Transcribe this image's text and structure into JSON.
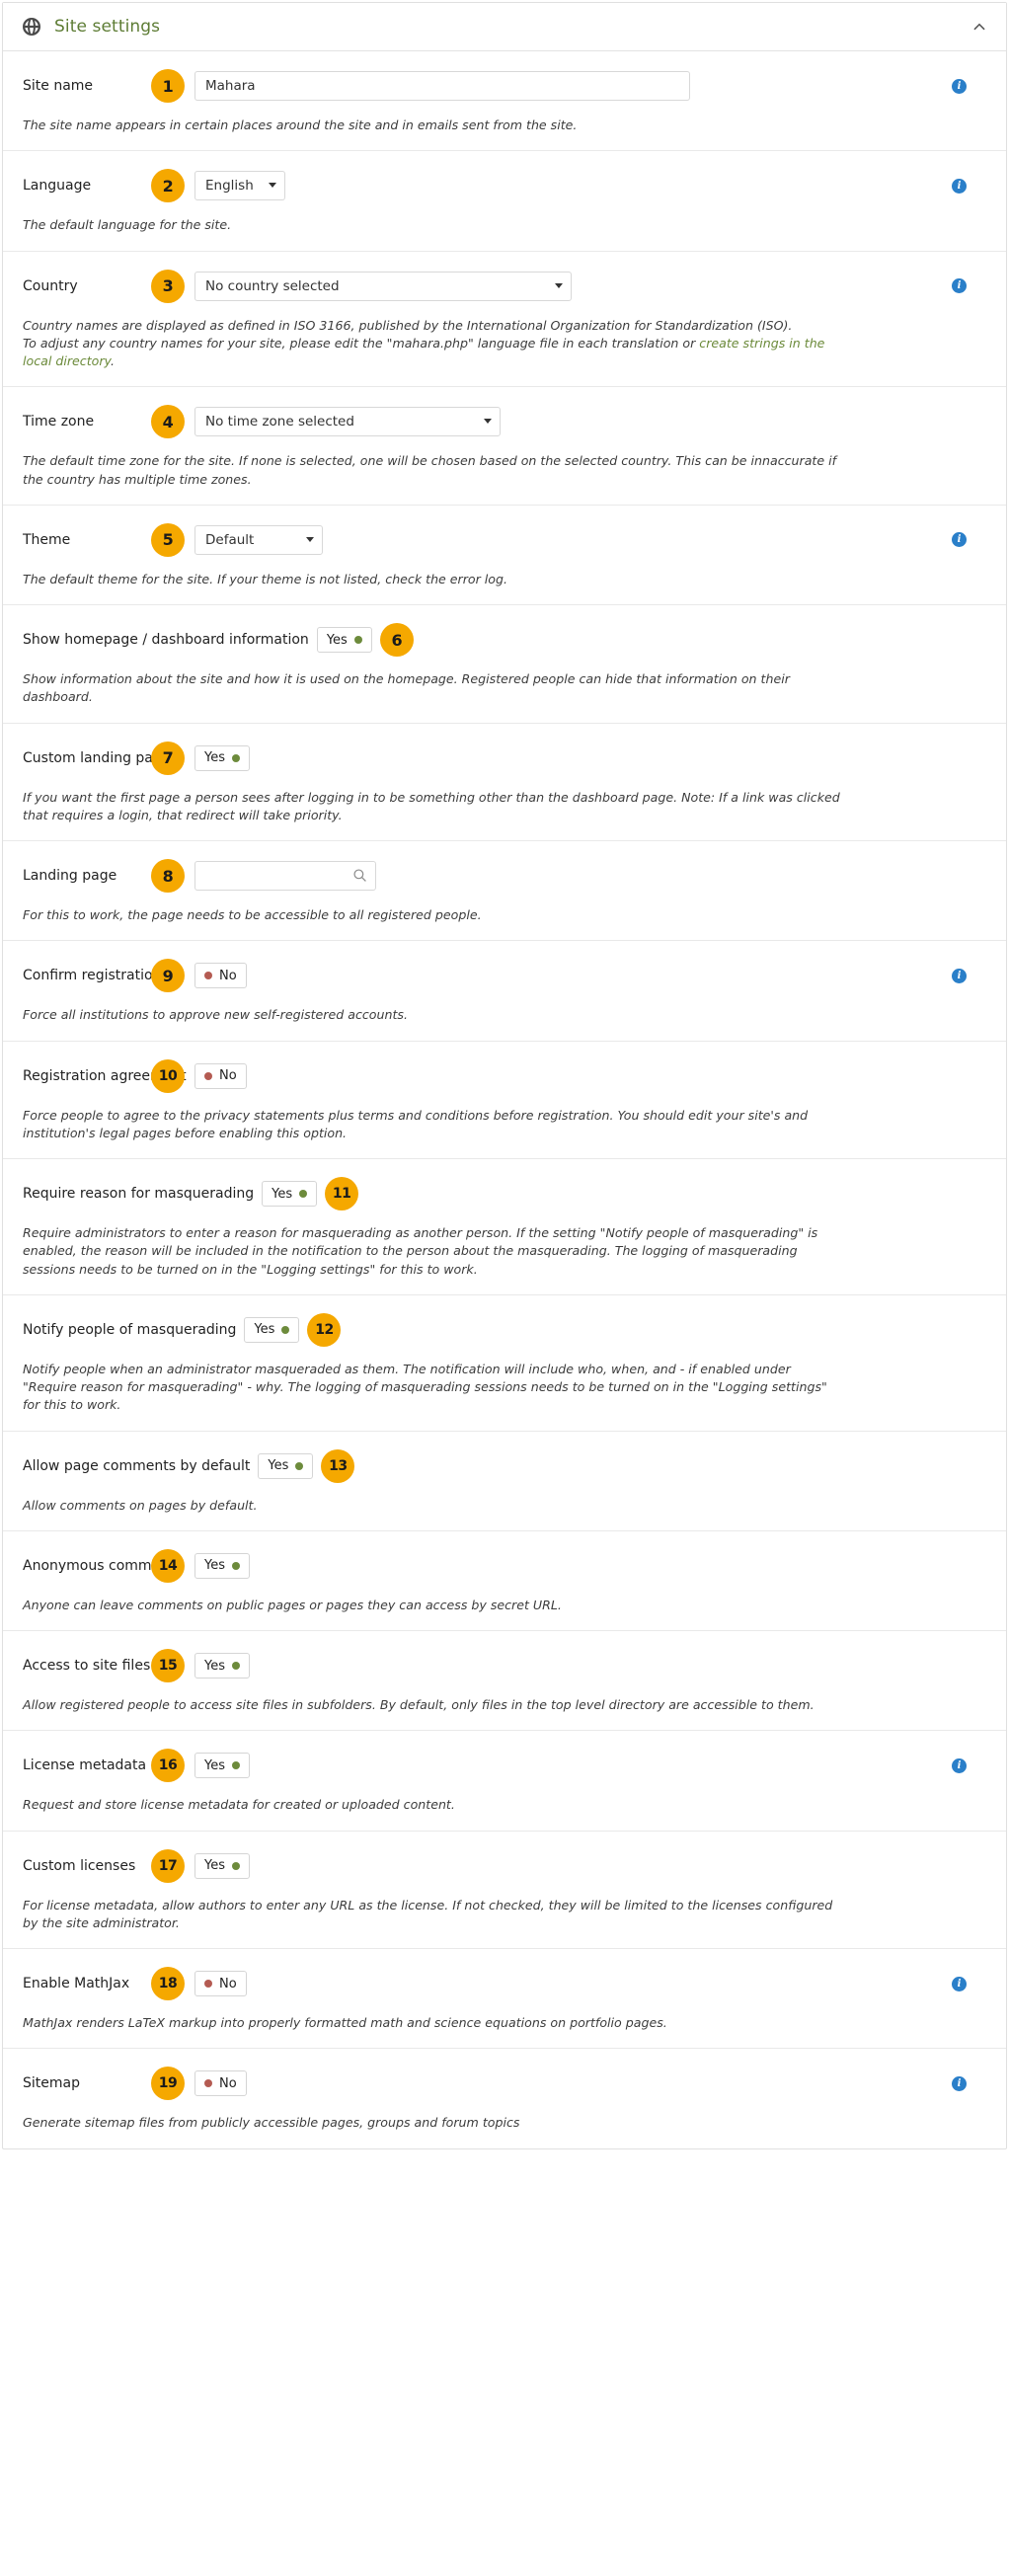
{
  "panel": {
    "title": "Site settings",
    "globe_icon": "globe-icon",
    "collapse_icon": "chevron-up-icon"
  },
  "rows": [
    {
      "num": "1",
      "label": "Site name",
      "control": "text",
      "value": "Mahara",
      "placeholder": "",
      "help": "The site name appears in certain places around the site and in emails sent from the site.",
      "info": true
    },
    {
      "num": "2",
      "label": "Language",
      "control": "select",
      "value": "English",
      "help": "The default language for the site.",
      "info": true
    },
    {
      "num": "3",
      "label": "Country",
      "control": "select",
      "value": "No country selected",
      "help_pre": "Country names are displayed as defined in ISO 3166, published by the International Organization for Standardization (ISO).\nTo adjust any country names for your site, please edit the \"mahara.php\" language file in each translation or ",
      "help_link": "create strings in the local directory",
      "help_post": ".",
      "info": true
    },
    {
      "num": "4",
      "label": "Time zone",
      "control": "select",
      "value": "No time zone selected",
      "help": "The default time zone for the site. If none is selected, one will be chosen based on the selected country. This can be innaccurate if the country has multiple time zones.",
      "info": false
    },
    {
      "num": "5",
      "label": "Theme",
      "control": "select",
      "value": "Default",
      "help": "The default theme for the site. If your theme is not listed, check the error log.",
      "info": true
    },
    {
      "num": "6",
      "label": "Show homepage / dashboard information",
      "control": "toggle",
      "value": "Yes",
      "badge_after": true,
      "help": "Show information about the site and how it is used on the homepage. Registered people can hide that information on their dashboard.",
      "info": false
    },
    {
      "num": "7",
      "label": "Custom landing page",
      "control": "toggle",
      "value": "Yes",
      "help": "If you want the first page a person sees after logging in to be something other than the dashboard page. Note: If a link was clicked that requires a login, that redirect will take priority.",
      "info": false
    },
    {
      "num": "8",
      "label": "Landing page",
      "control": "search",
      "value": "",
      "placeholder": "",
      "help": "For this to work, the page needs to be accessible to all registered people.",
      "info": false
    },
    {
      "num": "9",
      "label": "Confirm registration",
      "control": "toggle",
      "value": "No",
      "help": "Force all institutions to approve new self-registered accounts.",
      "info": true
    },
    {
      "num": "10",
      "label": "Registration agreement",
      "control": "toggle",
      "value": "No",
      "help": "Force people to agree to the privacy statements plus terms and conditions before registration. You should edit your site's and institution's legal pages before enabling this option.",
      "info": false
    },
    {
      "num": "11",
      "label": "Require reason for masquerading",
      "control": "toggle",
      "value": "Yes",
      "badge_after": true,
      "help": "Require administrators to enter a reason for masquerading as another person. If the setting \"Notify people of masquerading\" is enabled, the reason will be included in the notification to the person about the masquerading. The logging of masquerading sessions needs to be turned on in the \"Logging settings\" for this to work.",
      "info": false
    },
    {
      "num": "12",
      "label": "Notify people of masquerading",
      "control": "toggle",
      "value": "Yes",
      "badge_after": true,
      "help": "Notify people when an administrator masqueraded as them. The notification will include who, when, and - if enabled under \"Require reason for masquerading\" - why. The logging of masquerading sessions needs to be turned on in the \"Logging settings\" for this to work.",
      "info": false
    },
    {
      "num": "13",
      "label": "Allow page comments by default",
      "control": "toggle",
      "value": "Yes",
      "badge_after": true,
      "help": "Allow comments on pages by default.",
      "info": false
    },
    {
      "num": "14",
      "label": "Anonymous comments",
      "control": "toggle",
      "value": "Yes",
      "help": "Anyone can leave comments on public pages or pages they can access by secret URL.",
      "info": false
    },
    {
      "num": "15",
      "label": "Access to site files",
      "control": "toggle",
      "value": "Yes",
      "help": "Allow registered people to access site files in subfolders. By default, only files in the top level directory are accessible to them.",
      "info": false
    },
    {
      "num": "16",
      "label": "License metadata",
      "control": "toggle",
      "value": "Yes",
      "help": "Request and store license metadata for created or uploaded content.",
      "info": true
    },
    {
      "num": "17",
      "label": "Custom licenses",
      "control": "toggle",
      "value": "Yes",
      "help": "For license metadata, allow authors to enter any URL as the license. If not checked, they will be limited to the licenses configured by the site administrator.",
      "info": false
    },
    {
      "num": "18",
      "label": "Enable MathJax",
      "control": "toggle",
      "value": "No",
      "help": "MathJax renders LaTeX markup into properly formatted math and science equations on portfolio pages.",
      "info": true
    },
    {
      "num": "19",
      "label": "Sitemap",
      "control": "toggle",
      "value": "No",
      "help": "Generate sitemap files from publicly accessible pages, groups and forum topics",
      "info": true
    }
  ],
  "colors": {
    "badge": "#f5a800",
    "link": "#6b8a3a",
    "title": "#5d7c34",
    "info": "#2a7fc9",
    "yes_dot": "#6d8b3c",
    "no_dot": "#b45b52"
  },
  "info_glyph": "i"
}
